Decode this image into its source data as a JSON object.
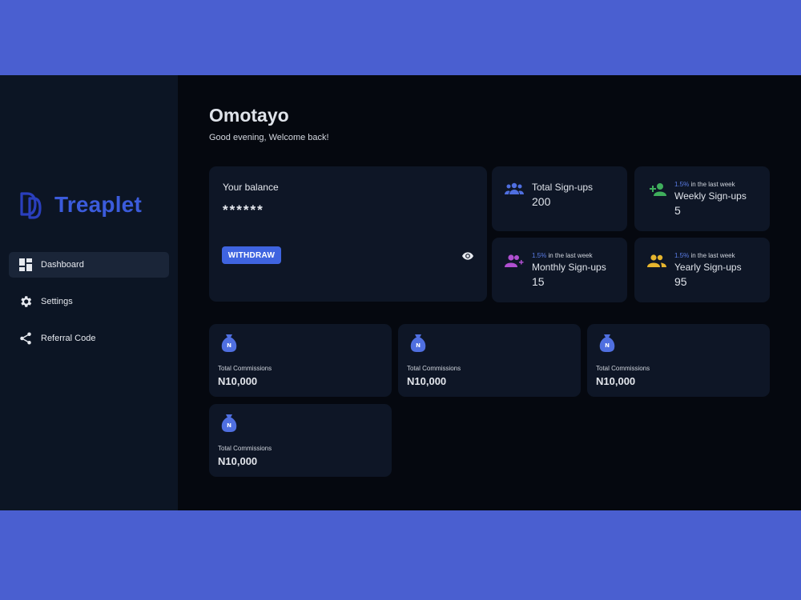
{
  "brand": {
    "name": "Treaplet",
    "color": "#3b5bdb"
  },
  "sidebar": {
    "items": [
      {
        "label": "Dashboard",
        "icon": "dashboard-icon",
        "active": true
      },
      {
        "label": "Settings",
        "icon": "gear-icon",
        "active": false
      },
      {
        "label": "Referral Code",
        "icon": "share-icon",
        "active": false
      }
    ]
  },
  "header": {
    "name": "Omotayo",
    "greeting": "Good evening, Welcome back!"
  },
  "balance": {
    "title": "Your balance",
    "value": "******",
    "withdraw_label": "WITHDRAW",
    "toggle_icon": "eye-icon"
  },
  "stats": [
    {
      "label": "Total Sign-ups",
      "value": "200",
      "icon": "group-icon",
      "icon_color": "#4f6fe0"
    },
    {
      "pct": "1.5%",
      "note": " in the last week",
      "label": "Weekly Sign-ups",
      "value": "5",
      "icon": "person-add-icon",
      "icon_color": "#3fae5c"
    },
    {
      "pct": "1.5%",
      "note": " in the last week",
      "label": "Monthly Sign-ups",
      "value": "15",
      "icon": "group-add-icon",
      "icon_color": "#b04fd0"
    },
    {
      "pct": "1.5%",
      "note": " in the last week",
      "label": "Yearly Sign-ups",
      "value": "95",
      "icon": "group-icon",
      "icon_color": "#e6b52e"
    }
  ],
  "commissions": [
    {
      "label": "Total Commissions",
      "value": "N10,000",
      "icon": "money-bag-icon"
    },
    {
      "label": "Total Commissions",
      "value": "N10,000",
      "icon": "money-bag-icon"
    },
    {
      "label": "Total Commissions",
      "value": "N10,000",
      "icon": "money-bag-icon"
    },
    {
      "label": "Total Commissions",
      "value": "N10,000",
      "icon": "money-bag-icon"
    }
  ],
  "colors": {
    "frame": "#4a5fd0",
    "sidebar_bg": "#0c1524",
    "main_bg": "#05080f",
    "card_bg": "#0e1626",
    "accent": "#3f64e0"
  }
}
